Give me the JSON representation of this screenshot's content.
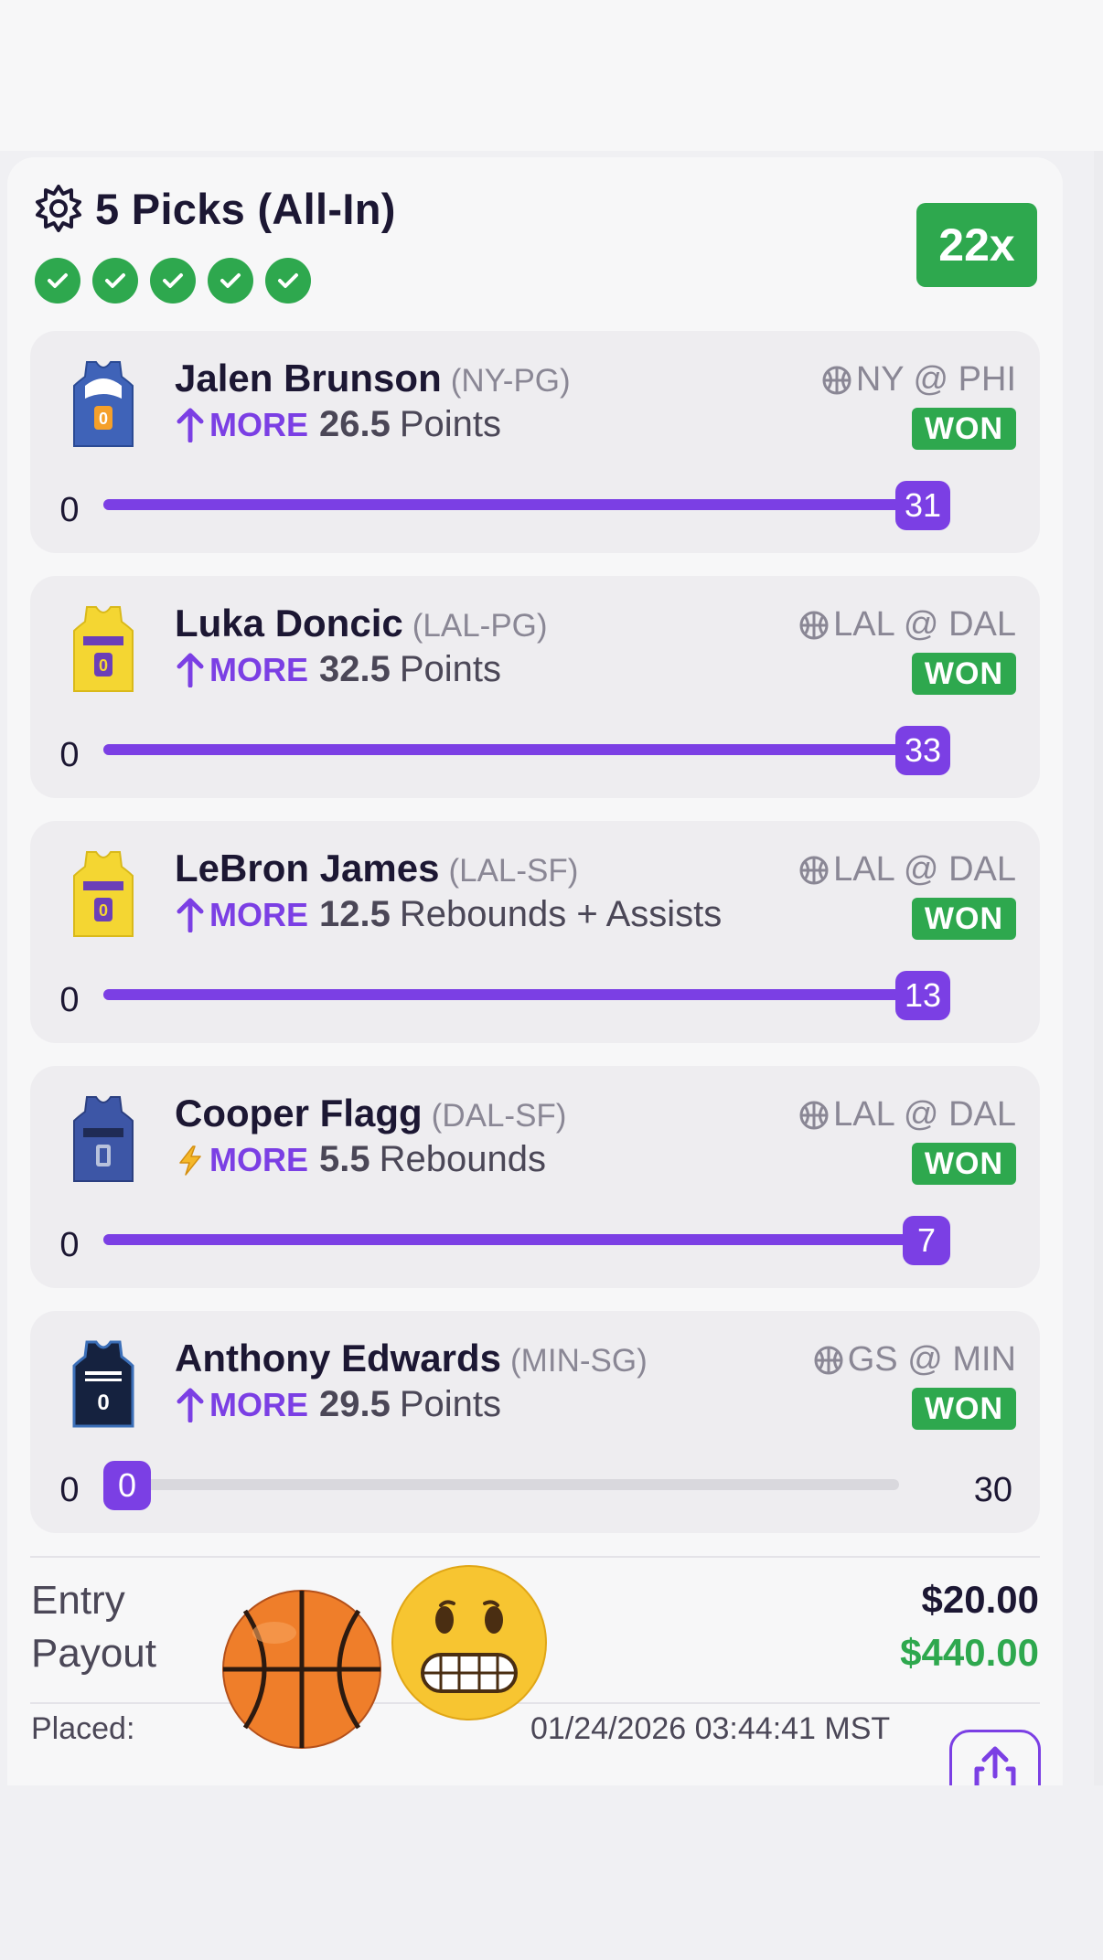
{
  "lineup": {
    "title": "5 Picks (All-In)",
    "multiplier": "22x",
    "check_count": 5
  },
  "picks": [
    {
      "player": "Jalen Brunson",
      "team": "(NY-PG)",
      "direction": "MORE",
      "line": "26.5",
      "stat": "Points",
      "matchup": "NY @ PHI",
      "status": "WON",
      "progress_min": "0",
      "actual": "31",
      "progress_fraction": 1.0,
      "jersey": "knicks-jersey",
      "direction_icon": "arrow-up-icon"
    },
    {
      "player": "Luka Doncic",
      "team": "(LAL-PG)",
      "direction": "MORE",
      "line": "32.5",
      "stat": "Points",
      "matchup": "LAL @ DAL",
      "status": "WON",
      "progress_min": "0",
      "actual": "33",
      "progress_fraction": 1.0,
      "jersey": "lakers-jersey",
      "direction_icon": "arrow-up-icon"
    },
    {
      "player": "LeBron James",
      "team": "(LAL-SF)",
      "direction": "MORE",
      "line": "12.5",
      "stat": "Rebounds + Assists",
      "matchup": "LAL @ DAL",
      "status": "WON",
      "progress_min": "0",
      "actual": "13",
      "progress_fraction": 1.0,
      "jersey": "lakers-jersey",
      "direction_icon": "arrow-up-icon"
    },
    {
      "player": "Cooper Flagg",
      "team": "(DAL-SF)",
      "direction": "MORE",
      "line": "5.5",
      "stat": "Rebounds",
      "matchup": "LAL @ DAL",
      "status": "WON",
      "progress_min": "0",
      "actual": "7",
      "progress_fraction": 1.0,
      "jersey": "mavericks-jersey",
      "direction_icon": "lightning-icon"
    },
    {
      "player": "Anthony Edwards",
      "team": "(MIN-SG)",
      "direction": "MORE",
      "line": "29.5",
      "stat": "Points",
      "matchup": "GS @ MIN",
      "status": "WON",
      "progress_min": "0",
      "actual": "0",
      "progress_max": "30",
      "progress_fraction": 0.0,
      "jersey": "timberwolves-jersey",
      "direction_icon": "arrow-up-icon"
    }
  ],
  "summary": {
    "entry_label": "Entry",
    "entry_value": "$20.00",
    "payout_label": "Payout",
    "payout_value": "$440.00",
    "placed_label": "Placed:",
    "placed_value": "01/24/2026 03:44:41 MST"
  },
  "colors": {
    "accent": "#7b3fe4",
    "won": "#2ea84e",
    "text": "#1c1733",
    "muted": "#8a8795"
  }
}
